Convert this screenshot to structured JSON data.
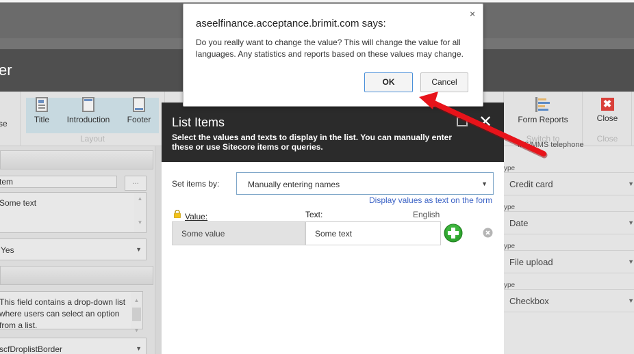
{
  "app": {
    "header_title_fragment": "er"
  },
  "ribbon": {
    "partial_left_label": "se",
    "layout_group": {
      "label": "Layout",
      "buttons": [
        {
          "label": "Title",
          "icon": "title-page-icon"
        },
        {
          "label": "Introduction",
          "icon": "introduction-page-icon"
        },
        {
          "label": "Footer",
          "icon": "footer-page-icon"
        }
      ]
    },
    "switch_group": {
      "label": "Switch to",
      "buttons": [
        {
          "label": "Form Reports",
          "icon": "form-reports-icon"
        }
      ]
    },
    "close_group": {
      "label": "Close",
      "buttons": [
        {
          "label": "Close",
          "icon": "close-red-icon"
        }
      ]
    }
  },
  "left_panel": {
    "item_field": "tem",
    "browse_button": "...",
    "text_area": "Some text",
    "yes_select": "Yes",
    "help_text": "This field contains a drop-down list where users can select an option from a list.",
    "css_select": "scfDroplistBorder"
  },
  "right_panel": {
    "top_partial": "MS/MMS telephone",
    "fields": [
      {
        "label": "ype",
        "value": "Credit card"
      },
      {
        "label": "ype",
        "value": "Date"
      },
      {
        "label": "ype",
        "value": "File upload"
      },
      {
        "label": "ype",
        "value": "Checkbox"
      }
    ]
  },
  "list_items_dialog": {
    "title": "List Items",
    "description": "Select the values and texts to display in the list. You can manually enter these or use Sitecore items or queries.",
    "set_items_label": "Set items by:",
    "set_items_value": "Manually entering names",
    "display_link": "Display values as text on the form",
    "value_header": "Value:",
    "text_header": "Text:",
    "language": "English",
    "rows": [
      {
        "value": "Some value",
        "text": "Some text"
      }
    ]
  },
  "alert": {
    "title": "aseelfinance.acceptance.brimit.com says:",
    "message": "Do you really want to change the value? This will change the value for all languages. Any statistics and reports based on these values may change.",
    "ok_label": "OK",
    "cancel_label": "Cancel",
    "close_glyph": "×"
  },
  "colors": {
    "annotation_arrow": "#e8131a",
    "dialog_header": "#2b2b2b",
    "link": "#3d64c6",
    "add_green": "#2fa52f"
  }
}
